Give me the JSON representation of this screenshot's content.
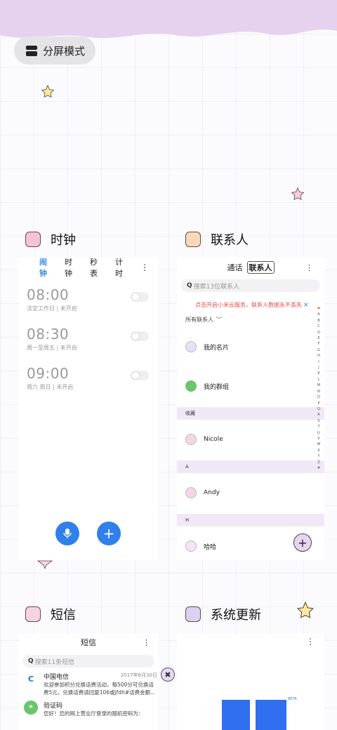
{
  "split_mode": {
    "label": "分屏模式"
  },
  "apps": {
    "clock": {
      "title": "时钟",
      "tabs": [
        "闹钟",
        "时钟",
        "秒表",
        "计时"
      ],
      "more": "⋮",
      "alarms": [
        {
          "time": "08:00",
          "sub": "法定工作日 | 未开启",
          "enabled": false
        },
        {
          "time": "08:30",
          "sub": "周一至周五 | 未开启",
          "enabled": false
        },
        {
          "time": "09:00",
          "sub": "周六 周日 | 未开启",
          "enabled": false
        }
      ],
      "mic_icon": "mic-icon",
      "add_symbol": "+"
    },
    "contacts": {
      "title": "联系人",
      "tab_calls": "通话",
      "tab_contacts": "联系人",
      "more": "⋮",
      "search_placeholder": "搜索13位联系人",
      "cloud_banner": "点击开启小米云服务，联系人数据永不丢失",
      "close_symbol": "×",
      "filter": "所有联系人",
      "my_card": "我的名片",
      "my_groups": "我的群组",
      "section_favorites": "收藏",
      "contact_nicole": "Nicole",
      "section_a": "A",
      "contact_andy": "Andy",
      "section_h": "H",
      "contact_haha": "哈哈",
      "index_letters": [
        "❤",
        "A",
        "B",
        "C",
        "D",
        "E",
        "F",
        "G",
        "H",
        "I",
        "J",
        "K",
        "L",
        "M",
        "N",
        "O",
        "P",
        "Q",
        "R",
        "S",
        "T",
        "U",
        "V",
        "W",
        "X",
        "Y",
        "Z",
        "#"
      ],
      "add_symbol": "+"
    },
    "sms": {
      "title": "短信",
      "header": "短信",
      "more": "⋮",
      "search_placeholder": "搜索11条短信",
      "messages": [
        {
          "sender": "中国电信",
          "date": "2017年6月30日",
          "body": "欢迎参加积分兑换话费活动，每500分可兑换话费5元，兑换话费请回复106或jfdh#话费金额..."
        },
        {
          "sender": "验证码",
          "date": "",
          "body": "您好！您的网上营业厅登录的随机密码为："
        }
      ]
    },
    "update": {
      "title": "系统更新",
      "more": "⋮",
      "beta": "BETA"
    }
  },
  "close_symbol": "✖",
  "colors": {
    "accent_blue": "#2f80ea",
    "lilac": "#e6d4f1",
    "banner_red": "#e04b4b"
  }
}
